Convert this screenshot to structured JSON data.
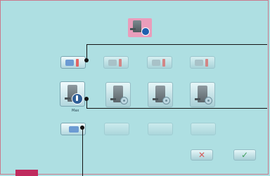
{
  "screen": {
    "background": "#aedfe2",
    "border_color": "#c97a8c"
  },
  "header": {
    "icon": "machine-settings-icon"
  },
  "rows": {
    "small_tiles": [
      {
        "name": "mode-tile-1",
        "state": "selected"
      },
      {
        "name": "mode-tile-2",
        "state": "dim"
      },
      {
        "name": "mode-tile-3",
        "state": "dim"
      },
      {
        "name": "mode-tile-4",
        "state": "dim"
      }
    ],
    "big_tiles": [
      {
        "name": "machine-tile-1",
        "state": "selected",
        "caption": "Max"
      },
      {
        "name": "machine-tile-2",
        "state": "normal"
      },
      {
        "name": "machine-tile-3",
        "state": "normal"
      },
      {
        "name": "machine-tile-4",
        "state": "normal"
      }
    ],
    "bottom_tiles": [
      {
        "name": "option-tile-1",
        "state": "selected"
      },
      {
        "name": "option-tile-2",
        "state": "ghost"
      },
      {
        "name": "option-tile-3",
        "state": "ghost"
      },
      {
        "name": "option-tile-4",
        "state": "ghost"
      }
    ]
  },
  "actions": {
    "cancel_symbol": "✕",
    "confirm_symbol": "✓"
  },
  "colors": {
    "accent": "#1f5fae",
    "warning": "#e16464",
    "pink": "#ea9dbb",
    "corner": "#c02b5e"
  }
}
